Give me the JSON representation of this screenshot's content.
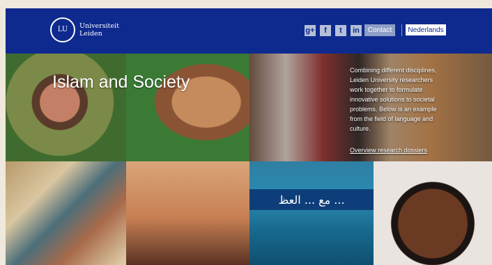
{
  "header": {
    "brand": {
      "line1": "Universiteit",
      "line2": "Leiden",
      "seal_text": "LU"
    },
    "social": [
      {
        "name": "google-plus-icon",
        "glyph": "g+"
      },
      {
        "name": "facebook-icon",
        "glyph": "f"
      },
      {
        "name": "twitter-icon",
        "glyph": "t"
      },
      {
        "name": "linkedin-icon",
        "glyph": "in"
      }
    ],
    "contact_label": "Contact",
    "language_label": "Nederlands"
  },
  "hero": {
    "title": "Islam and Society",
    "intro": "Combining different disciplines, Leiden University researchers work together to formulate innovative solutions to societal problems. Below is an example from the field of language and culture.",
    "link_label": "Overview research dossiers"
  },
  "tiles": {
    "script_text": "مع ... العظ ..."
  },
  "colors": {
    "brand_blue": "#0e2a8e",
    "contact_bg": "#8e9ec6",
    "language_bg": "#ffffff"
  }
}
